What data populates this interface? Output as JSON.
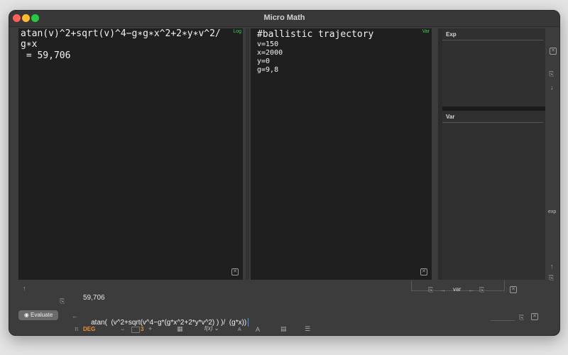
{
  "window": {
    "title": "Micro Math"
  },
  "log_pane": {
    "tag": "Log",
    "lines": [
      "atan(v)^2+sqrt(v)^4−g∗g∗x^2+2∗y∗v^2/",
      "g∗x",
      " = 59,706"
    ]
  },
  "var_pane": {
    "tag": "Var",
    "heading": "#ballistic trajectory",
    "lines": [
      "v=150",
      "x=2000",
      "y=0",
      "g=9,8"
    ]
  },
  "right_panel": {
    "exp_header": "Exp",
    "var_header": "Var",
    "side_label": "exp"
  },
  "bottom": {
    "result": "59,706",
    "expression": "atan(  (v^2+sqrt(v^4−g*(g*x^2+2*y*v^2) ) )/  (g*x))",
    "evaluate_label": "Evaluate",
    "var_button_label": "var",
    "angle_mode": "DEG",
    "precision": "3",
    "function_label": "f(x)"
  },
  "colors": {
    "tag_green": "#3fd04a",
    "deg_orange": "#e8932e",
    "caret_blue": "#4a8ff5"
  }
}
